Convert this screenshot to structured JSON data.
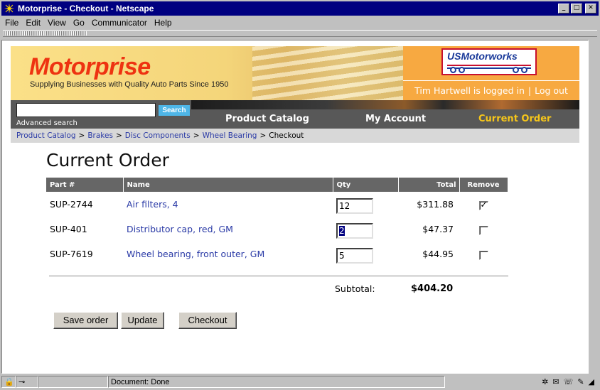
{
  "window": {
    "title": "Motorprise - Checkout - Netscape"
  },
  "menu": [
    "File",
    "Edit",
    "View",
    "Go",
    "Communicator",
    "Help"
  ],
  "header": {
    "logo": "Motorprise",
    "tagline": "Supplying Businesses with Quality Auto Parts Since 1950",
    "partner_logo": "USMotorworks",
    "login_text": "Tim Hartwell is logged in",
    "separator": "|",
    "logout_label": "Log out"
  },
  "search": {
    "button_label": "Search",
    "advanced_label": "Advanced search",
    "value": ""
  },
  "nav": {
    "items": [
      {
        "label": "Product Catalog"
      },
      {
        "label": "My Account"
      },
      {
        "label": "Current Order"
      }
    ]
  },
  "breadcrumb": {
    "links": [
      "Product Catalog",
      "Brakes",
      "Disc Components",
      "Wheel Bearing"
    ],
    "separator": ">",
    "current": "Checkout"
  },
  "order": {
    "title": "Current Order",
    "columns": [
      "Part #",
      "Name",
      "Qty",
      "Total",
      "Remove"
    ],
    "rows": [
      {
        "part": "SUP-2744",
        "name": "Air filters, 4",
        "qty": "12",
        "total": "$311.88",
        "remove": true
      },
      {
        "part": "SUP-401",
        "name": "Distributor cap, red, GM",
        "qty": "2",
        "total": "$47.37",
        "remove": false
      },
      {
        "part": "SUP-7619",
        "name": "Wheel bearing, front outer, GM",
        "qty": "5",
        "total": "$44.95",
        "remove": false
      }
    ],
    "subtotal_label": "Subtotal:",
    "subtotal_value": "$404.20",
    "buttons": {
      "save": "Save order",
      "update": "Update",
      "checkout": "Checkout"
    }
  },
  "status": {
    "text": "Document: Done"
  },
  "colors": {
    "brand_red": "#ee3311",
    "nav_active": "#f6c61a",
    "link": "#2a3aa6",
    "header_orange": "#f7a941"
  }
}
